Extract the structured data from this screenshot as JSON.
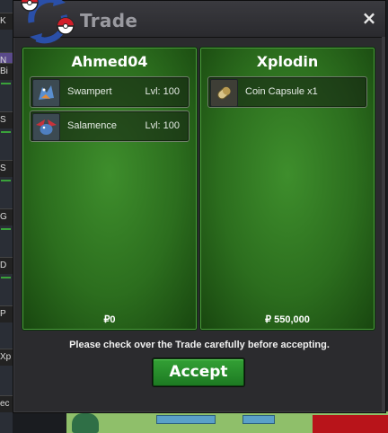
{
  "window": {
    "title": "Trade",
    "close_glyph": "×",
    "logo_icon": "pokeball-trade-icon"
  },
  "background": {
    "left_fragments": [
      "K",
      "N",
      "Bi",
      "S",
      "S",
      "G",
      "D",
      "P",
      "Xp",
      "ec"
    ]
  },
  "left_panel": {
    "player": "Ahmed04",
    "items": [
      {
        "name": "Swampert",
        "level": "Lvl: 100",
        "icon": "swampert-icon"
      },
      {
        "name": "Salamence",
        "level": "Lvl: 100",
        "icon": "salamence-icon"
      }
    ],
    "money": "₽0"
  },
  "right_panel": {
    "player": "Xplodin",
    "items": [
      {
        "name": "Coin Capsule  x1",
        "icon": "coin-capsule-icon"
      }
    ],
    "money": "₽ 550,000"
  },
  "notice": "Please check over the Trade carefully before accepting.",
  "accept_label": "Accept",
  "colors": {
    "panel_green": "#2c6e1e",
    "accept_green": "#2a8f2d",
    "window_bg": "#2b2b2e"
  }
}
